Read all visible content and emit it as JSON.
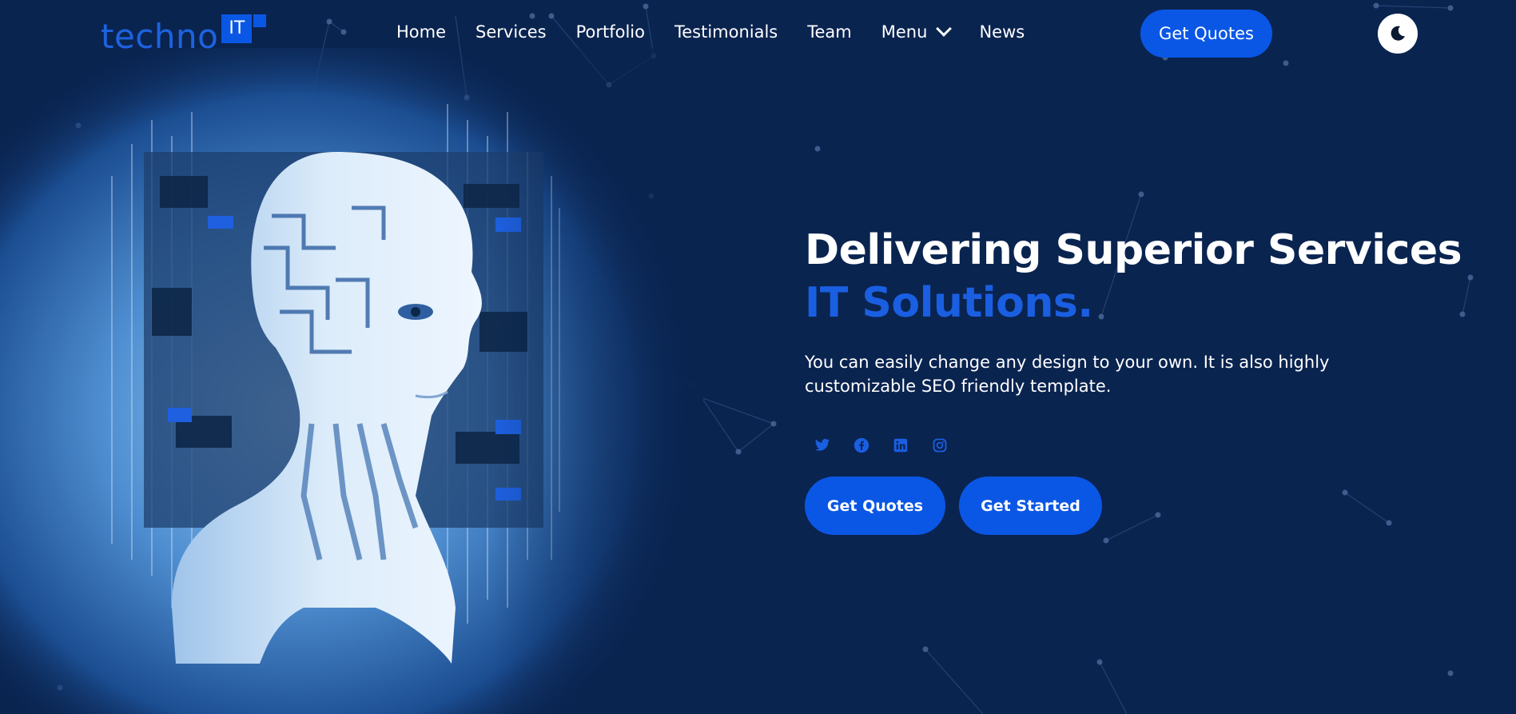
{
  "brand": {
    "logo_text": "techno",
    "logo_badge": "IT",
    "primary_color": "#0a57e6",
    "background_color": "#0a2450"
  },
  "nav": {
    "items": [
      {
        "label": "Home"
      },
      {
        "label": "Services"
      },
      {
        "label": "Portfolio"
      },
      {
        "label": "Testimonials"
      },
      {
        "label": "Team"
      },
      {
        "label": "Menu",
        "icon": "chevron-down-icon"
      },
      {
        "label": "News"
      }
    ]
  },
  "header": {
    "cta_label": "Get Quotes",
    "theme_toggle_icon": "moon-icon"
  },
  "hero": {
    "title": "Delivering Superior Services",
    "title_accent": "IT Solutions.",
    "description": "You can easily change any design to your own. It is also highly customizable SEO friendly template.",
    "image": "ai-robot-head",
    "socials": [
      {
        "name": "twitter-icon"
      },
      {
        "name": "facebook-icon"
      },
      {
        "name": "linkedin-icon"
      },
      {
        "name": "instagram-icon"
      }
    ],
    "buttons": {
      "primary": "Get Quotes",
      "secondary": "Get Started"
    }
  }
}
